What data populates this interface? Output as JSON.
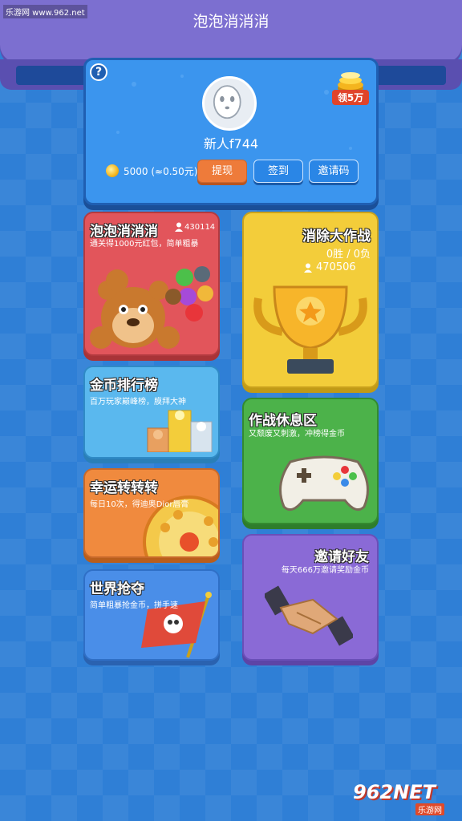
{
  "watermark": {
    "top": "乐游网 www.962.net",
    "bottom_logo": "962NET",
    "bottom_text": "乐游网"
  },
  "header": {
    "title": "泡泡消消消"
  },
  "profile": {
    "help": "?",
    "reward_label": "领5万",
    "username": "新人f744",
    "balance": "5000 (≈0.50元)",
    "buttons": {
      "withdraw": "提现",
      "signin": "签到",
      "invite": "邀请码"
    }
  },
  "tiles": {
    "bubble": {
      "title": "泡泡消消消",
      "players": "430114",
      "desc": "通关得1000元红包，简单粗暴"
    },
    "rank": {
      "title": "金币排行榜",
      "desc": "百万玩家巅峰榜，膜拜大神"
    },
    "spin": {
      "title": "幸运转转转",
      "desc": "每日10次，得迪奥Dior唇膏"
    },
    "world": {
      "title": "世界抢夺",
      "desc": "简单粗暴抢金币，拼手速"
    },
    "battle": {
      "title": "消除大作战",
      "record": "0胜 / 0负",
      "players": "470506"
    },
    "rest": {
      "title": "作战休息区",
      "desc": "又颓废又刺激，冲榜得金币"
    },
    "friend": {
      "title": "邀请好友",
      "desc": "每天666万邀请奖励金币"
    }
  },
  "colors": {
    "background": "#2f7fd6",
    "header": "#7c6fd0",
    "accent_orange": "#ee7b3a",
    "accent_blue": "#2a86e6"
  }
}
